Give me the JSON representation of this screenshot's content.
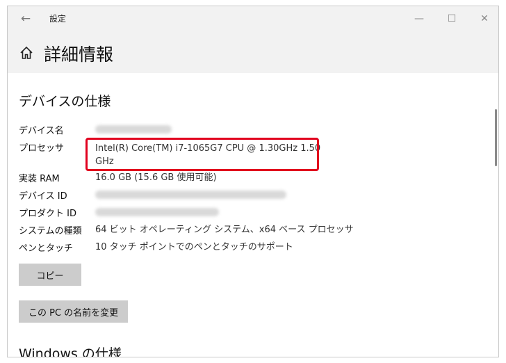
{
  "window": {
    "title": "設定",
    "back_glyph": "←",
    "minimize_glyph": "—",
    "maximize_glyph": "☐",
    "close_glyph": "✕"
  },
  "header": {
    "title": "詳細情報",
    "home_icon": "home-icon"
  },
  "device_spec": {
    "heading": "デバイスの仕様",
    "rows": [
      {
        "label": "デバイス名",
        "value": "",
        "redacted": true
      },
      {
        "label": "プロセッサ",
        "value": "Intel(R) Core(TM) i7-1065G7 CPU @ 1.30GHz   1.50 GHz",
        "redacted": false
      },
      {
        "label": "実装 RAM",
        "value": "16.0 GB (15.6 GB 使用可能)",
        "redacted": false
      },
      {
        "label": "デバイス ID",
        "value": "",
        "redacted": true
      },
      {
        "label": "プロダクト ID",
        "value": "",
        "redacted": true
      },
      {
        "label": "システムの種類",
        "value": "64 ビット オペレーティング システム、x64 ベース プロセッサ",
        "redacted": false
      },
      {
        "label": "ペンとタッチ",
        "value": "10 タッチ ポイントでのペンとタッチのサポート",
        "redacted": false
      }
    ],
    "copy_button": "コピー",
    "rename_button": "この PC の名前を変更"
  },
  "windows_spec": {
    "heading": "Windows の仕様"
  },
  "colors": {
    "highlight": "#e1001e",
    "button_bg": "#cccccc",
    "header_bg": "#f2f2f2"
  }
}
